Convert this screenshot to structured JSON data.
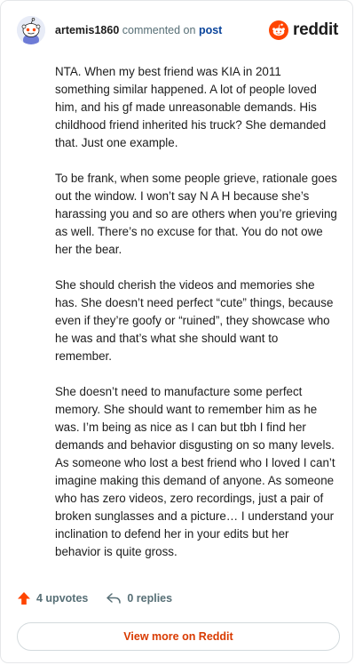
{
  "header": {
    "username": "artemis1860",
    "action_text": "commented on",
    "post_link": "post",
    "brand": "reddit"
  },
  "comment": {
    "paragraphs": [
      "NTA. When my best friend was KIA in 2011 something similar happened. A lot of people loved him, and his gf made unreasonable demands. His childhood friend inherited his truck? She demanded that. Just one example.",
      "To be frank, when some people grieve, rationale goes out the window. I won’t say N A H because she’s harassing you and so are others when you’re grieving as well. There’s no excuse for that. You do not owe her the bear.",
      "She should cherish the videos and memories she has. She doesn’t need perfect “cute” things, because even if they’re goofy or “ruined”, they showcase who he was and that’s what she should want to remember.",
      "She doesn’t need to manufacture some perfect memory. She should want to remember him as he was. I’m being as nice as I can but tbh I find her demands and behavior disgusting on so many levels. As someone who lost a best friend who I loved I can’t imagine making this demand of anyone. As someone who has zero videos, zero recordings, just a pair of broken sunglasses and a picture… I understand your inclination to defend her in your edits but her behavior is quite gross."
    ]
  },
  "actions": {
    "upvotes": "4 upvotes",
    "replies": "0 replies"
  },
  "footer": {
    "view_more": "View more on Reddit"
  },
  "colors": {
    "accent": "#ff4500",
    "link": "#d93a00",
    "muted": "#576f76"
  },
  "icons": {
    "avatar": "snoo-avatar",
    "logo": "reddit-logo-icon",
    "upvote": "upvote-arrow-icon",
    "reply": "reply-arrow-icon"
  }
}
